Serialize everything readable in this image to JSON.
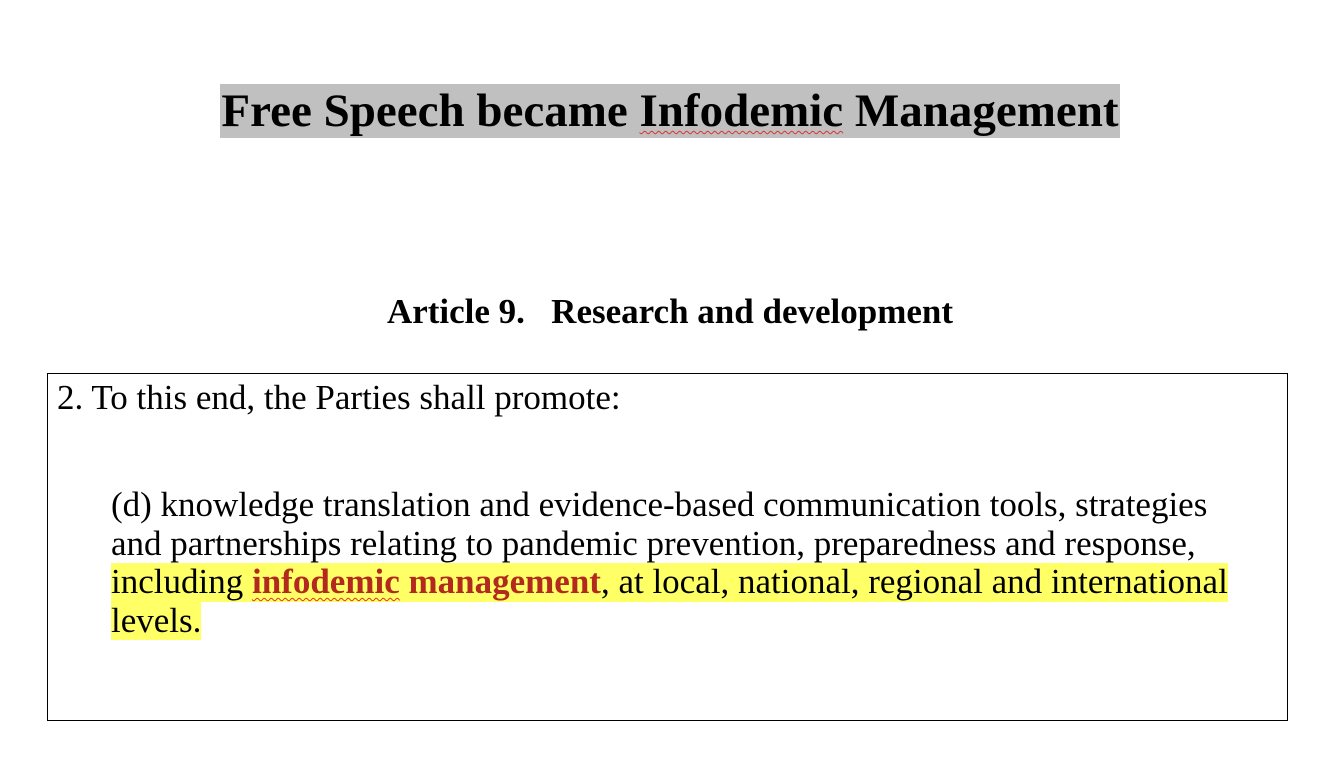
{
  "document": {
    "title": {
      "part1": "Free Speech became ",
      "part2": "Infodemic",
      "part3": " Management"
    },
    "article_heading": "Article 9.   Research and development",
    "quote": {
      "intro": "2. To this end, the Parties shall promote:",
      "line1": "(d) knowledge translation and evidence-based communication tools, strategies",
      "line2": "and partnerships relating to pandemic prevention, preparedness and response,",
      "line3_start": "including ",
      "line3_key1": "infodemic",
      "line3_gap": " ",
      "line3_key2": "management",
      "line3_rest": ", at local, national, regional and international ",
      "line4": "levels."
    },
    "colors": {
      "title_highlight": "#c0c0c0",
      "text_highlight": "#ffff66",
      "key_text": "#b22a1e",
      "spellcheck_underline": "#e03030"
    }
  }
}
